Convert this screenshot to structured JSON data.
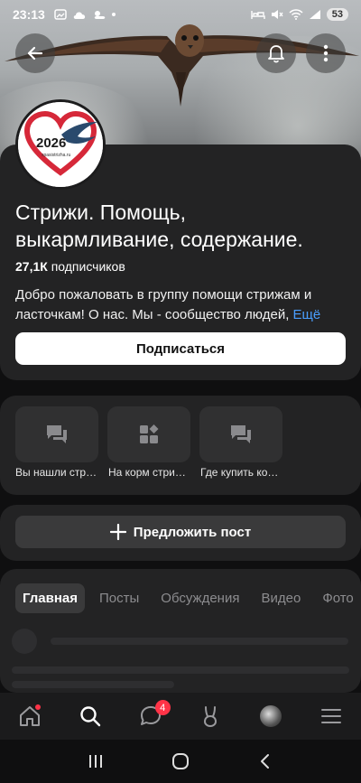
{
  "status_bar": {
    "time": "23:13",
    "battery": "53"
  },
  "group": {
    "logo_year": "2026",
    "logo_site": "spasistrizha.ru",
    "title": "Стрижи. Помощь, выкармливание, содержание.",
    "subscribers_count": "27,1К",
    "subscribers_label": "подписчиков",
    "description": "Добро пожаловать в группу помощи стрижам и ласточкам! О нас. Мы - сообщество людей,",
    "more_label": "Ещё",
    "subscribe_label": "Подписаться"
  },
  "links": [
    {
      "label": "Вы нашли стр…",
      "icon": "chat-bubbles-icon"
    },
    {
      "label": "На корм стри…",
      "icon": "widgets-icon"
    },
    {
      "label": "Где купить ко…",
      "icon": "chat-bubbles-icon"
    }
  ],
  "suggest_post_label": "Предложить пост",
  "tabs": [
    "Главная",
    "Посты",
    "Обсуждения",
    "Видео",
    "Фото"
  ],
  "active_tab": "Главная",
  "bottom_nav": {
    "messages_badge": "4",
    "items": [
      "home-icon",
      "search-icon",
      "messages-icon",
      "clips-icon",
      "profile-avatar",
      "menu-icon"
    ]
  },
  "colors": {
    "accent_link": "#4a9eff",
    "badge": "#ff3347",
    "card_bg": "#232324",
    "background": "#0f0f10"
  }
}
